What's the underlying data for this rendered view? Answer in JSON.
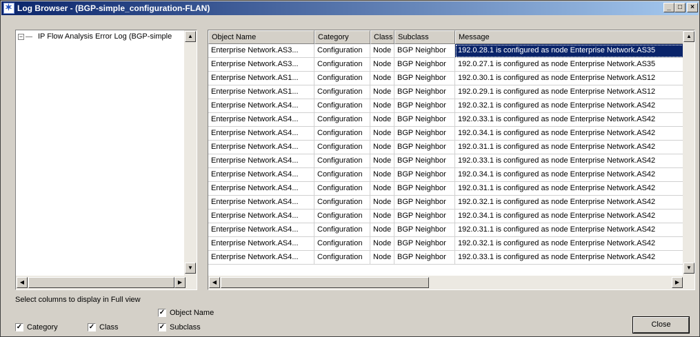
{
  "window": {
    "title": "Log Browser - (BGP-simple_configuration-FLAN)",
    "min_label": "_",
    "max_label": "□",
    "close_label": "×"
  },
  "tree": {
    "root_label": "IP Flow Analysis Error Log (BGP-simple",
    "expander": "−"
  },
  "table": {
    "columns": [
      "Object Name",
      "Category",
      "Class",
      "Subclass",
      "Message"
    ],
    "rows": [
      [
        "Enterprise Network.AS3...",
        "Configuration",
        "Node",
        "BGP Neighbor",
        "192.0.28.1 is configured as node Enterprise Network.AS35"
      ],
      [
        "Enterprise Network.AS3...",
        "Configuration",
        "Node",
        "BGP Neighbor",
        "192.0.27.1 is configured as node Enterprise Network.AS35"
      ],
      [
        "Enterprise Network.AS1...",
        "Configuration",
        "Node",
        "BGP Neighbor",
        "192.0.30.1 is configured as node Enterprise Network.AS12"
      ],
      [
        "Enterprise Network.AS1...",
        "Configuration",
        "Node",
        "BGP Neighbor",
        "192.0.29.1 is configured as node Enterprise Network.AS12"
      ],
      [
        "Enterprise Network.AS4...",
        "Configuration",
        "Node",
        "BGP Neighbor",
        "192.0.32.1 is configured as node Enterprise Network.AS42"
      ],
      [
        "Enterprise Network.AS4...",
        "Configuration",
        "Node",
        "BGP Neighbor",
        "192.0.33.1 is configured as node Enterprise Network.AS42"
      ],
      [
        "Enterprise Network.AS4...",
        "Configuration",
        "Node",
        "BGP Neighbor",
        "192.0.34.1 is configured as node Enterprise Network.AS42"
      ],
      [
        "Enterprise Network.AS4...",
        "Configuration",
        "Node",
        "BGP Neighbor",
        "192.0.31.1 is configured as node Enterprise Network.AS42"
      ],
      [
        "Enterprise Network.AS4...",
        "Configuration",
        "Node",
        "BGP Neighbor",
        "192.0.33.1 is configured as node Enterprise Network.AS42"
      ],
      [
        "Enterprise Network.AS4...",
        "Configuration",
        "Node",
        "BGP Neighbor",
        "192.0.34.1 is configured as node Enterprise Network.AS42"
      ],
      [
        "Enterprise Network.AS4...",
        "Configuration",
        "Node",
        "BGP Neighbor",
        "192.0.31.1 is configured as node Enterprise Network.AS42"
      ],
      [
        "Enterprise Network.AS4...",
        "Configuration",
        "Node",
        "BGP Neighbor",
        "192.0.32.1 is configured as node Enterprise Network.AS42"
      ],
      [
        "Enterprise Network.AS4...",
        "Configuration",
        "Node",
        "BGP Neighbor",
        "192.0.34.1 is configured as node Enterprise Network.AS42"
      ],
      [
        "Enterprise Network.AS4...",
        "Configuration",
        "Node",
        "BGP Neighbor",
        "192.0.31.1 is configured as node Enterprise Network.AS42"
      ],
      [
        "Enterprise Network.AS4...",
        "Configuration",
        "Node",
        "BGP Neighbor",
        "192.0.32.1 is configured as node Enterprise Network.AS42"
      ],
      [
        "Enterprise Network.AS4...",
        "Configuration",
        "Node",
        "BGP Neighbor",
        "192.0.33.1 is configured as node Enterprise Network.AS42"
      ]
    ],
    "selected_row": 0
  },
  "footer": {
    "select_label": "Select columns to display in Full view",
    "checkboxes": {
      "object_name": {
        "label": "Object Name",
        "checked": true
      },
      "category": {
        "label": "Category",
        "checked": true
      },
      "class": {
        "label": "Class",
        "checked": true
      },
      "subclass": {
        "label": "Subclass",
        "checked": true
      }
    },
    "close_button": "Close"
  },
  "colors": {
    "title_start": "#0a246a",
    "title_end": "#a6caf0",
    "selection": "#0a246a",
    "face": "#d4d0c8"
  }
}
